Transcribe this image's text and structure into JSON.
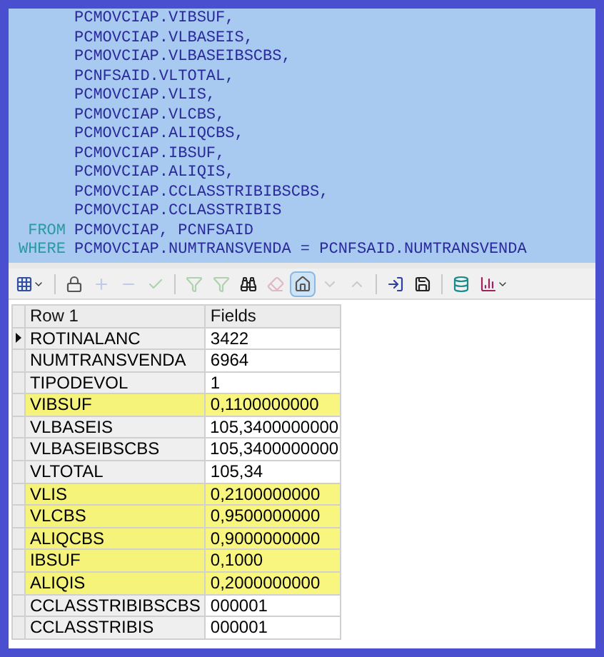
{
  "sql_editor": {
    "lines": [
      {
        "text": "PCMOVCIAP.VIBSUF,"
      },
      {
        "text": "PCMOVCIAP.VLBASEIS,"
      },
      {
        "text": "PCMOVCIAP.VLBASEIBSCBS,"
      },
      {
        "text": "PCNFSAID.VLTOTAL,"
      },
      {
        "text": "PCMOVCIAP.VLIS,"
      },
      {
        "text": "PCMOVCIAP.VLCBS,"
      },
      {
        "text": "PCMOVCIAP.ALIQCBS,"
      },
      {
        "text": "PCMOVCIAP.IBSUF,"
      },
      {
        "text": "PCMOVCIAP.ALIQIS,"
      },
      {
        "text": "PCMOVCIAP.CCLASSTRIBIBSCBS,"
      },
      {
        "text": "PCMOVCIAP.CCLASSTRIBIS"
      },
      {
        "keyword": "FROM",
        "text": "PCMOVCIAP, PCNFSAID"
      },
      {
        "keyword": "WHERE",
        "text": "PCMOVCIAP.NUMTRANSVENDA = PCNFSAID.NUMTRANSVENDA"
      }
    ]
  },
  "toolbar": [
    {
      "kind": "grid",
      "disabled": false,
      "selected": false,
      "dropdown": true
    },
    {
      "kind": "separator"
    },
    {
      "kind": "lock",
      "disabled": false,
      "selected": false
    },
    {
      "kind": "plus",
      "disabled": true,
      "selected": false
    },
    {
      "kind": "minus",
      "disabled": true,
      "selected": false
    },
    {
      "kind": "check",
      "disabled": true,
      "selected": false
    },
    {
      "kind": "separator"
    },
    {
      "kind": "filter",
      "disabled": true,
      "selected": false
    },
    {
      "kind": "filter",
      "disabled": true,
      "selected": false
    },
    {
      "kind": "binoculars",
      "disabled": false,
      "selected": false
    },
    {
      "kind": "eraser",
      "disabled": true,
      "selected": false
    },
    {
      "kind": "home",
      "disabled": false,
      "selected": true
    },
    {
      "kind": "down",
      "disabled": true,
      "selected": false
    },
    {
      "kind": "up",
      "disabled": true,
      "selected": false
    },
    {
      "kind": "separator"
    },
    {
      "kind": "export",
      "disabled": false,
      "selected": false
    },
    {
      "kind": "save",
      "disabled": false,
      "selected": false
    },
    {
      "kind": "separator"
    },
    {
      "kind": "database",
      "disabled": false,
      "selected": false
    },
    {
      "kind": "chart",
      "disabled": false,
      "selected": false,
      "dropdown": true
    }
  ],
  "table": {
    "columns": [
      "Row 1",
      "Fields"
    ],
    "rows": [
      {
        "field": "ROTINALANC",
        "value": "3422",
        "current": true,
        "highlighted": false
      },
      {
        "field": "NUMTRANSVENDA",
        "value": "6964",
        "current": false,
        "highlighted": false
      },
      {
        "field": "TIPODEVOL",
        "value": "1",
        "current": false,
        "highlighted": false
      },
      {
        "field": "VIBSUF",
        "value": "0,1100000000",
        "current": false,
        "highlighted": true
      },
      {
        "field": "VLBASEIS",
        "value": "105,3400000000",
        "current": false,
        "highlighted": false
      },
      {
        "field": "VLBASEIBSCBS",
        "value": "105,3400000000",
        "current": false,
        "highlighted": false
      },
      {
        "field": "VLTOTAL",
        "value": "105,34",
        "current": false,
        "highlighted": false
      },
      {
        "field": "VLIS",
        "value": "0,2100000000",
        "current": false,
        "highlighted": true
      },
      {
        "field": "VLCBS",
        "value": "0,9500000000",
        "current": false,
        "highlighted": true
      },
      {
        "field": "ALIQCBS",
        "value": "0,9000000000",
        "current": false,
        "highlighted": true
      },
      {
        "field": "IBSUF",
        "value": "0,1000",
        "current": false,
        "highlighted": true
      },
      {
        "field": "ALIQIS",
        "value": "0,2000000000",
        "current": false,
        "highlighted": true
      },
      {
        "field": "CCLASSTRIBIBSCBS",
        "value": "000001",
        "current": false,
        "highlighted": false
      },
      {
        "field": "CCLASSTRIBIS",
        "value": "000001",
        "current": false,
        "highlighted": false
      }
    ]
  }
}
